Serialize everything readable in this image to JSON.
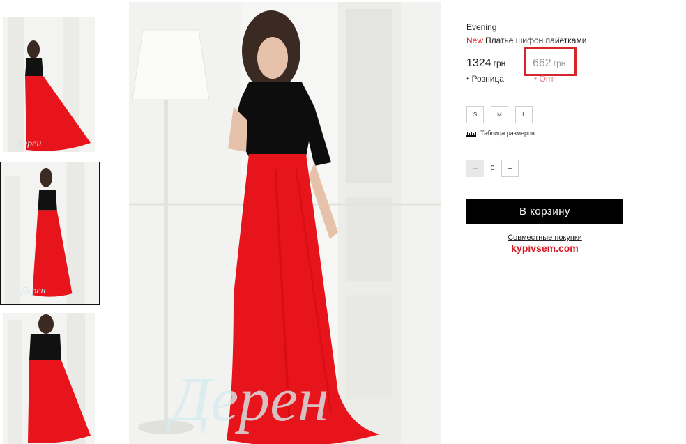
{
  "product": {
    "brand": "Evening",
    "new_badge": "New",
    "title": "Платье шифон пайетками"
  },
  "prices": {
    "retail_value": "1324",
    "retail_currency": "грн",
    "retail_label": "Розница",
    "wholesale_value": "662",
    "wholesale_currency": "грн",
    "wholesale_label": "Опт"
  },
  "sizes": [
    "S",
    "M",
    "L"
  ],
  "size_table_label": "Таблица размеров",
  "quantity": {
    "minus": "–",
    "value": "0",
    "plus": "+"
  },
  "cart_button_label": "В корзину",
  "joint_purchases": {
    "link_label": "Совместные покупки",
    "site": "kypivsem.com"
  },
  "colors": {
    "accent_red": "#e0262c",
    "highlight_box": "#d3262d",
    "dress_red": "#e8141b",
    "button_black": "#000000"
  }
}
